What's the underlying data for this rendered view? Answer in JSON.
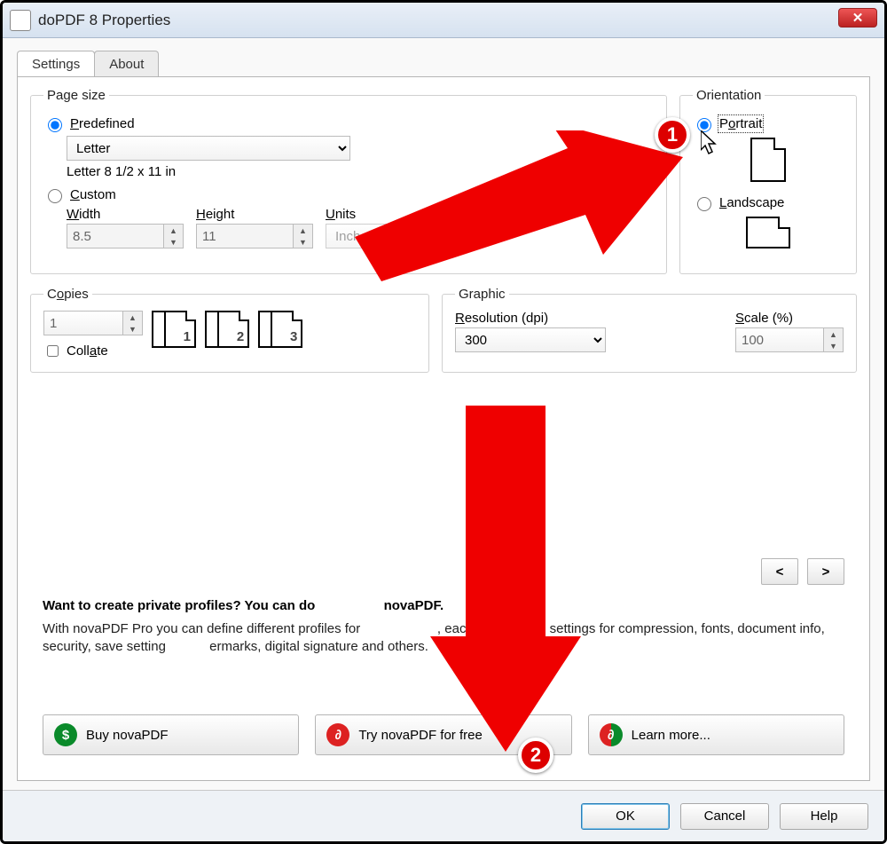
{
  "title": "doPDF 8 Properties",
  "tabs": {
    "settings": "Settings",
    "about": "About"
  },
  "pageSize": {
    "legend": "Page size",
    "predefined": {
      "label": "Predefined",
      "value": "Letter",
      "description": "Letter 8 1/2 x 11 in"
    },
    "custom": "Custom",
    "width": {
      "label": "Width",
      "value": "8.5"
    },
    "height": {
      "label": "Height",
      "value": "11"
    },
    "units": {
      "label": "Units",
      "value": "Inches"
    }
  },
  "orientation": {
    "legend": "Orientation",
    "portrait": "Portrait",
    "landscape": "Landscape"
  },
  "copies": {
    "legend": "Copies",
    "value": "1",
    "collate": "Collate"
  },
  "graphic": {
    "legend": "Graphic",
    "resolution": {
      "label": "Resolution (dpi)",
      "value": "300"
    },
    "scale": {
      "label": "Scale (%)",
      "value": "100"
    }
  },
  "promo": {
    "heading_prefix": "Want to create private profiles? You can do",
    "heading_suffix": "novaPDF.",
    "body_prefix": "With novaPDF Pro you can define different profiles for",
    "body_mid": ", each with its own settings for compression, fonts, document info, security, save setting",
    "body_suffix": "ermarks, digital signature and others.",
    "prev": "<",
    "next": ">"
  },
  "promoButtons": {
    "buy": "Buy novaPDF",
    "try": "Try novaPDF for free",
    "learn": "Learn more..."
  },
  "footer": {
    "ok": "OK",
    "cancel": "Cancel",
    "help": "Help"
  },
  "annotations": {
    "badge1": "1",
    "badge2": "2"
  }
}
